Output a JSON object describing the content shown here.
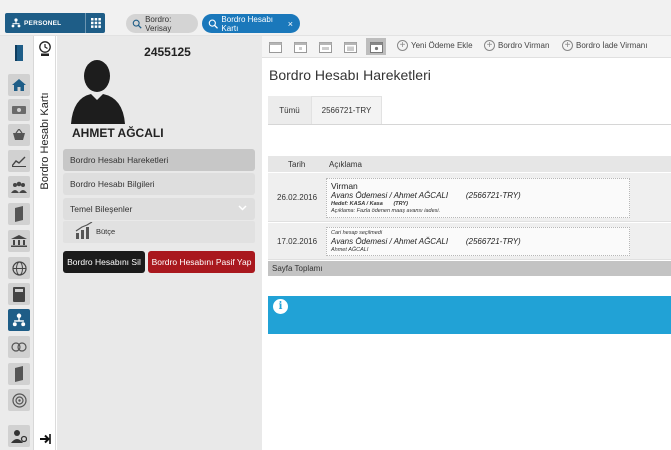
{
  "app": {
    "brand_label": "PERSONEL"
  },
  "tabs": [
    {
      "label": "Bordro: Verisay"
    },
    {
      "label": "Bordro Hesabı Kartı",
      "close": "×"
    }
  ],
  "rail": {
    "icons": [
      "home-icon",
      "money-icon",
      "basket-icon",
      "chart-icon",
      "people-icon",
      "book-icon",
      "bank-icon",
      "globe-icon",
      "calculator-icon",
      "org-chart-icon",
      "coins-icon",
      "book-icon",
      "target-icon",
      "user-settings-icon"
    ],
    "active_index": 9
  },
  "panel": {
    "vertical_title": "Bordro Hesabı Kartı",
    "id": "2455125",
    "name": "AHMET AĞCALI",
    "menu": [
      {
        "label": "Bordro Hesabı Hareketleri",
        "selected": true
      },
      {
        "label": "Bordro Hesabı Bilgileri",
        "selected": false
      },
      {
        "label": "Temel Bileşenler",
        "selected": false
      }
    ],
    "submenu_item": "Bütçe",
    "delete_button": "Bordro Hesabını Sil",
    "passive_button": "Bordro Hesabını Pasif Yap"
  },
  "toolbar": {
    "actions": [
      "Yeni Ödeme Ekle",
      "Bordro Virman",
      "Bordro İade Virmanı"
    ]
  },
  "content": {
    "title": "Bordro Hesabı Hareketleri",
    "subtabs": [
      "Tümü",
      "2566721-TRY"
    ],
    "table": {
      "columns": [
        "Tarih",
        "Açıklama"
      ],
      "rows": [
        {
          "date": "26.02.2016",
          "title": "Virman",
          "line": "Avans Ödemesi / Ahmet AĞCALI        (2566721-TRY)",
          "target": "Hedef: KASA / Kasa       (TRY)",
          "note": "Açıklama: Fazla ödenen maaş avansı iadesi."
        },
        {
          "date": "17.02.2016",
          "title": "Cari hesap seçilmedi",
          "line": "Avans Ödemesi / Ahmet AĞCALI        (2566721-TRY)",
          "note": "Ahmet AĞCALI"
        }
      ]
    },
    "footer_label": "Sayfa Toplamı",
    "info_icon": "i"
  },
  "colors": {
    "brand": "#1e5d87",
    "active_tab": "#1a78bb",
    "danger": "#a9181e",
    "info": "#21a2d6"
  }
}
